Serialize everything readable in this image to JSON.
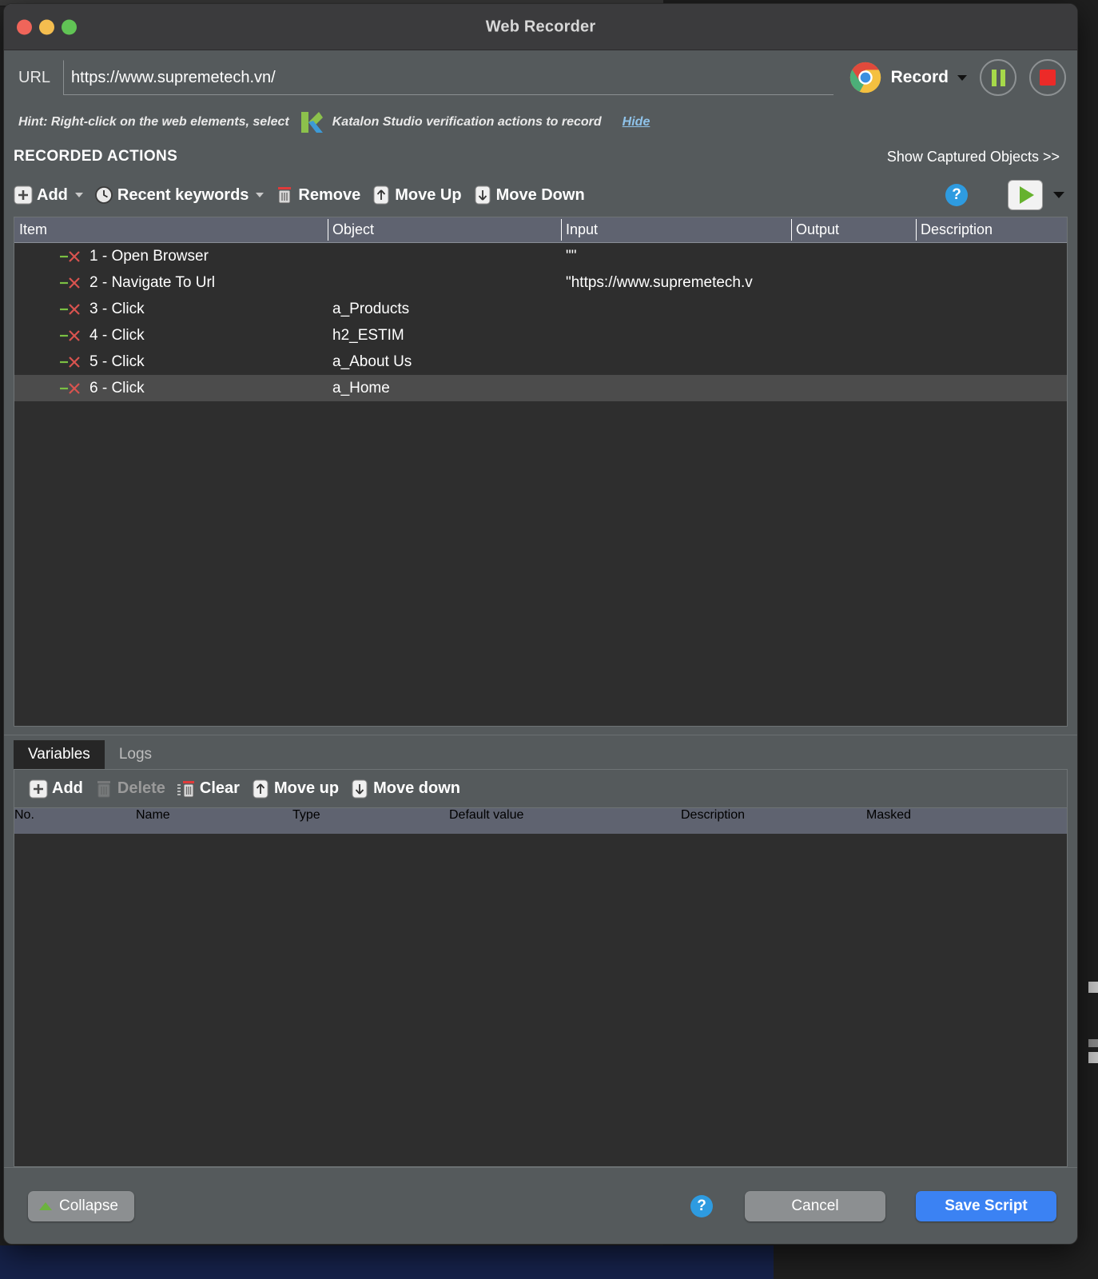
{
  "window": {
    "title": "Web Recorder",
    "traffic_lights": [
      "close",
      "minimize",
      "maximize"
    ]
  },
  "urlbar": {
    "label": "URL",
    "value": "https://www.supremetech.vn/",
    "placeholder": "",
    "browser_icon": "chrome-icon",
    "record_label": "Record",
    "pause_icon": "pause-icon",
    "stop_icon": "stop-icon"
  },
  "hint": {
    "text_before": "Hint: Right-click on the web elements, select",
    "logo": "katalon-logo",
    "text_after": "Katalon Studio verification actions to record",
    "hide_label": "Hide"
  },
  "recorded_actions": {
    "section_title": "RECORDED ACTIONS",
    "show_captured_objects": "Show Captured Objects >>",
    "toolbar": [
      {
        "label": "Add",
        "icon": "plus-icon",
        "caret": true,
        "disabled": false
      },
      {
        "label": "Recent keywords",
        "icon": "clock-icon",
        "caret": true,
        "disabled": false
      },
      {
        "label": "Remove",
        "icon": "trash-icon",
        "caret": false,
        "disabled": false
      },
      {
        "label": "Move Up",
        "icon": "arrow-up-icon",
        "caret": false,
        "disabled": false
      },
      {
        "label": "Move Down",
        "icon": "arrow-down-icon",
        "caret": false,
        "disabled": false
      }
    ],
    "help_label": "?",
    "play_icon": "play-icon",
    "columns": [
      "Item",
      "Object",
      "Input",
      "Output",
      "Description"
    ],
    "rows": [
      {
        "item": "1 - Open Browser",
        "object": "",
        "input": "\"\"",
        "output": "",
        "description": "",
        "selected": false
      },
      {
        "item": "2 - Navigate To Url",
        "object": "",
        "input": "\"https://www.supremetech.v",
        "output": "",
        "description": "",
        "selected": false
      },
      {
        "item": "3 - Click",
        "object": "a_Products",
        "input": "",
        "output": "",
        "description": "",
        "selected": false
      },
      {
        "item": "4 - Click",
        "object": "h2_ESTIM",
        "input": "",
        "output": "",
        "description": "",
        "selected": false
      },
      {
        "item": "5 - Click",
        "object": "a_About Us",
        "input": "",
        "output": "",
        "description": "",
        "selected": false
      },
      {
        "item": "6 - Click",
        "object": "a_Home",
        "input": "",
        "output": "",
        "description": "",
        "selected": true
      }
    ]
  },
  "bottom": {
    "tabs": [
      {
        "label": "Variables",
        "active": true
      },
      {
        "label": "Logs",
        "active": false
      }
    ],
    "toolbar": [
      {
        "label": "Add",
        "icon": "plus-icon",
        "disabled": false
      },
      {
        "label": "Delete",
        "icon": "trash-icon",
        "disabled": true
      },
      {
        "label": "Clear",
        "icon": "clear-list-icon",
        "disabled": false
      },
      {
        "label": "Move up",
        "icon": "arrow-up-icon",
        "disabled": false
      },
      {
        "label": "Move down",
        "icon": "arrow-down-icon",
        "disabled": false
      }
    ],
    "columns": [
      "No.",
      "Name",
      "Type",
      "Default value",
      "Description",
      "Masked"
    ],
    "rows": []
  },
  "footer": {
    "collapse_label": "Collapse",
    "help_label": "?",
    "cancel_label": "Cancel",
    "save_label": "Save Script"
  },
  "colors": {
    "window_bg": "#555a5c",
    "titlebar_bg": "#3b3b3d",
    "table_bg": "#2e2e2e",
    "table_header_bg": "#5f6370",
    "selected_row": "#4c4c4c",
    "accent_blue": "#3b82f3",
    "help_blue": "#2e9be0",
    "record_green": "#a6d94a",
    "stop_red": "#ec2a28",
    "play_green": "#66b22e",
    "link_blue": "#8fc3ea"
  }
}
